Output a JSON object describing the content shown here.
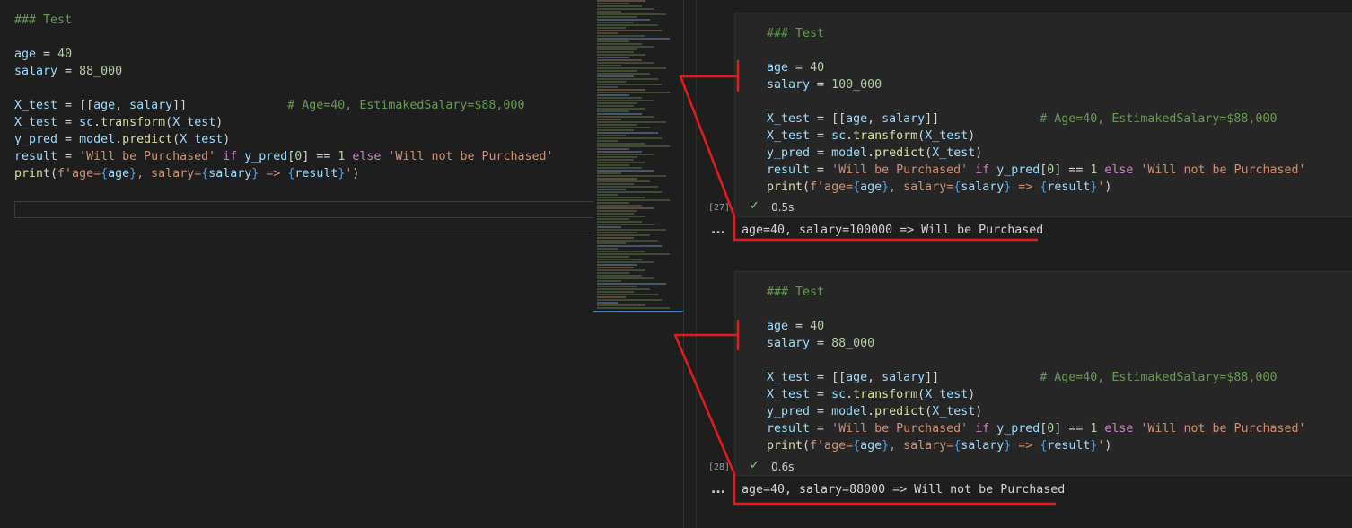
{
  "left_editor": {
    "lines": [
      [
        {
          "t": "### Test",
          "c": "comment"
        }
      ],
      [],
      [
        {
          "t": "age",
          "c": "var"
        },
        {
          "t": " = ",
          "c": "plain"
        },
        {
          "t": "40",
          "c": "num"
        }
      ],
      [
        {
          "t": "salary",
          "c": "var"
        },
        {
          "t": " = ",
          "c": "plain"
        },
        {
          "t": "88_000",
          "c": "num"
        }
      ],
      [],
      [
        {
          "t": "X_test",
          "c": "var"
        },
        {
          "t": " = [[",
          "c": "plain"
        },
        {
          "t": "age",
          "c": "var"
        },
        {
          "t": ", ",
          "c": "plain"
        },
        {
          "t": "salary",
          "c": "var"
        },
        {
          "t": "]]              ",
          "c": "plain"
        },
        {
          "t": "# Age=40, EstimakedSalary=$88,000",
          "c": "comment"
        }
      ],
      [
        {
          "t": "X_test",
          "c": "var"
        },
        {
          "t": " = ",
          "c": "plain"
        },
        {
          "t": "sc",
          "c": "var"
        },
        {
          "t": ".",
          "c": "plain"
        },
        {
          "t": "transform",
          "c": "fn"
        },
        {
          "t": "(",
          "c": "plain"
        },
        {
          "t": "X_test",
          "c": "var"
        },
        {
          "t": ")",
          "c": "plain"
        }
      ],
      [
        {
          "t": "y_pred",
          "c": "var"
        },
        {
          "t": " = ",
          "c": "plain"
        },
        {
          "t": "model",
          "c": "var"
        },
        {
          "t": ".",
          "c": "plain"
        },
        {
          "t": "predict",
          "c": "fn"
        },
        {
          "t": "(",
          "c": "plain"
        },
        {
          "t": "X_test",
          "c": "var"
        },
        {
          "t": ")",
          "c": "plain"
        }
      ],
      [
        {
          "t": "result",
          "c": "var"
        },
        {
          "t": " = ",
          "c": "plain"
        },
        {
          "t": "'Will be Purchased'",
          "c": "str"
        },
        {
          "t": " ",
          "c": "plain"
        },
        {
          "t": "if",
          "c": "kw"
        },
        {
          "t": " ",
          "c": "plain"
        },
        {
          "t": "y_pred",
          "c": "var"
        },
        {
          "t": "[",
          "c": "plain"
        },
        {
          "t": "0",
          "c": "num"
        },
        {
          "t": "] == ",
          "c": "plain"
        },
        {
          "t": "1",
          "c": "num"
        },
        {
          "t": " ",
          "c": "plain"
        },
        {
          "t": "else",
          "c": "kw"
        },
        {
          "t": " ",
          "c": "plain"
        },
        {
          "t": "'Will not be Purchased'",
          "c": "str"
        }
      ],
      [
        {
          "t": "print",
          "c": "fn"
        },
        {
          "t": "(",
          "c": "plain"
        },
        {
          "t": "f'age=",
          "c": "str"
        },
        {
          "t": "{",
          "c": "brace"
        },
        {
          "t": "age",
          "c": "var"
        },
        {
          "t": "}",
          "c": "brace"
        },
        {
          "t": ", salary=",
          "c": "str"
        },
        {
          "t": "{",
          "c": "brace"
        },
        {
          "t": "salary",
          "c": "var"
        },
        {
          "t": "}",
          "c": "brace"
        },
        {
          "t": " => ",
          "c": "str"
        },
        {
          "t": "{",
          "c": "brace"
        },
        {
          "t": "result",
          "c": "var"
        },
        {
          "t": "}",
          "c": "brace"
        },
        {
          "t": "'",
          "c": "str"
        },
        {
          "t": ")",
          "c": "plain"
        }
      ]
    ]
  },
  "cells": [
    {
      "exec_count": "[27]",
      "status_icon": "check-icon",
      "duration": "0.5s",
      "more_label": "...",
      "output": "age=40, salary=100000 => Will be Purchased",
      "lines": [
        [
          {
            "t": "### Test",
            "c": "comment"
          }
        ],
        [],
        [
          {
            "t": "age",
            "c": "var"
          },
          {
            "t": " = ",
            "c": "plain"
          },
          {
            "t": "40",
            "c": "num"
          }
        ],
        [
          {
            "t": "salary",
            "c": "var"
          },
          {
            "t": " = ",
            "c": "plain"
          },
          {
            "t": "100_000",
            "c": "num"
          }
        ],
        [],
        [
          {
            "t": "X_test",
            "c": "var"
          },
          {
            "t": " = [[",
            "c": "plain"
          },
          {
            "t": "age",
            "c": "var"
          },
          {
            "t": ", ",
            "c": "plain"
          },
          {
            "t": "salary",
            "c": "var"
          },
          {
            "t": "]]              ",
            "c": "plain"
          },
          {
            "t": "# Age=40, EstimakedSalary=$88,000",
            "c": "comment"
          }
        ],
        [
          {
            "t": "X_test",
            "c": "var"
          },
          {
            "t": " = ",
            "c": "plain"
          },
          {
            "t": "sc",
            "c": "var"
          },
          {
            "t": ".",
            "c": "plain"
          },
          {
            "t": "transform",
            "c": "fn"
          },
          {
            "t": "(",
            "c": "plain"
          },
          {
            "t": "X_test",
            "c": "var"
          },
          {
            "t": ")",
            "c": "plain"
          }
        ],
        [
          {
            "t": "y_pred",
            "c": "var"
          },
          {
            "t": " = ",
            "c": "plain"
          },
          {
            "t": "model",
            "c": "var"
          },
          {
            "t": ".",
            "c": "plain"
          },
          {
            "t": "predict",
            "c": "fn"
          },
          {
            "t": "(",
            "c": "plain"
          },
          {
            "t": "X_test",
            "c": "var"
          },
          {
            "t": ")",
            "c": "plain"
          }
        ],
        [
          {
            "t": "result",
            "c": "var"
          },
          {
            "t": " = ",
            "c": "plain"
          },
          {
            "t": "'Will be Purchased'",
            "c": "str"
          },
          {
            "t": " ",
            "c": "plain"
          },
          {
            "t": "if",
            "c": "kw"
          },
          {
            "t": " ",
            "c": "plain"
          },
          {
            "t": "y_pred",
            "c": "var"
          },
          {
            "t": "[",
            "c": "plain"
          },
          {
            "t": "0",
            "c": "num"
          },
          {
            "t": "] == ",
            "c": "plain"
          },
          {
            "t": "1",
            "c": "num"
          },
          {
            "t": " ",
            "c": "plain"
          },
          {
            "t": "else",
            "c": "kw"
          },
          {
            "t": " ",
            "c": "plain"
          },
          {
            "t": "'Will not be Purchased'",
            "c": "str"
          }
        ],
        [
          {
            "t": "print",
            "c": "fn"
          },
          {
            "t": "(",
            "c": "plain"
          },
          {
            "t": "f'age=",
            "c": "str"
          },
          {
            "t": "{",
            "c": "brace"
          },
          {
            "t": "age",
            "c": "var"
          },
          {
            "t": "}",
            "c": "brace"
          },
          {
            "t": ", salary=",
            "c": "str"
          },
          {
            "t": "{",
            "c": "brace"
          },
          {
            "t": "salary",
            "c": "var"
          },
          {
            "t": "}",
            "c": "brace"
          },
          {
            "t": " => ",
            "c": "str"
          },
          {
            "t": "{",
            "c": "brace"
          },
          {
            "t": "result",
            "c": "var"
          },
          {
            "t": "}",
            "c": "brace"
          },
          {
            "t": "'",
            "c": "str"
          },
          {
            "t": ")",
            "c": "plain"
          }
        ]
      ]
    },
    {
      "exec_count": "[28]",
      "status_icon": "check-icon",
      "duration": "0.6s",
      "more_label": "...",
      "output": "age=40, salary=88000 => Will not be Purchased",
      "lines": [
        [
          {
            "t": "### Test",
            "c": "comment"
          }
        ],
        [],
        [
          {
            "t": "age",
            "c": "var"
          },
          {
            "t": " = ",
            "c": "plain"
          },
          {
            "t": "40",
            "c": "num"
          }
        ],
        [
          {
            "t": "salary",
            "c": "var"
          },
          {
            "t": " = ",
            "c": "plain"
          },
          {
            "t": "88_000",
            "c": "num"
          }
        ],
        [],
        [
          {
            "t": "X_test",
            "c": "var"
          },
          {
            "t": " = [[",
            "c": "plain"
          },
          {
            "t": "age",
            "c": "var"
          },
          {
            "t": ", ",
            "c": "plain"
          },
          {
            "t": "salary",
            "c": "var"
          },
          {
            "t": "]]              ",
            "c": "plain"
          },
          {
            "t": "# Age=40, EstimakedSalary=$88,000",
            "c": "comment"
          }
        ],
        [
          {
            "t": "X_test",
            "c": "var"
          },
          {
            "t": " = ",
            "c": "plain"
          },
          {
            "t": "sc",
            "c": "var"
          },
          {
            "t": ".",
            "c": "plain"
          },
          {
            "t": "transform",
            "c": "fn"
          },
          {
            "t": "(",
            "c": "plain"
          },
          {
            "t": "X_test",
            "c": "var"
          },
          {
            "t": ")",
            "c": "plain"
          }
        ],
        [
          {
            "t": "y_pred",
            "c": "var"
          },
          {
            "t": " = ",
            "c": "plain"
          },
          {
            "t": "model",
            "c": "var"
          },
          {
            "t": ".",
            "c": "plain"
          },
          {
            "t": "predict",
            "c": "fn"
          },
          {
            "t": "(",
            "c": "plain"
          },
          {
            "t": "X_test",
            "c": "var"
          },
          {
            "t": ")",
            "c": "plain"
          }
        ],
        [
          {
            "t": "result",
            "c": "var"
          },
          {
            "t": " = ",
            "c": "plain"
          },
          {
            "t": "'Will be Purchased'",
            "c": "str"
          },
          {
            "t": " ",
            "c": "plain"
          },
          {
            "t": "if",
            "c": "kw"
          },
          {
            "t": " ",
            "c": "plain"
          },
          {
            "t": "y_pred",
            "c": "var"
          },
          {
            "t": "[",
            "c": "plain"
          },
          {
            "t": "0",
            "c": "num"
          },
          {
            "t": "] == ",
            "c": "plain"
          },
          {
            "t": "1",
            "c": "num"
          },
          {
            "t": " ",
            "c": "plain"
          },
          {
            "t": "else",
            "c": "kw"
          },
          {
            "t": " ",
            "c": "plain"
          },
          {
            "t": "'Will not be Purchased'",
            "c": "str"
          }
        ],
        [
          {
            "t": "print",
            "c": "fn"
          },
          {
            "t": "(",
            "c": "plain"
          },
          {
            "t": "f'age=",
            "c": "str"
          },
          {
            "t": "{",
            "c": "brace"
          },
          {
            "t": "age",
            "c": "var"
          },
          {
            "t": "}",
            "c": "brace"
          },
          {
            "t": ", salary=",
            "c": "str"
          },
          {
            "t": "{",
            "c": "brace"
          },
          {
            "t": "salary",
            "c": "var"
          },
          {
            "t": "}",
            "c": "brace"
          },
          {
            "t": " => ",
            "c": "str"
          },
          {
            "t": "{",
            "c": "brace"
          },
          {
            "t": "result",
            "c": "var"
          },
          {
            "t": "}",
            "c": "brace"
          },
          {
            "t": "'",
            "c": "str"
          },
          {
            "t": ")",
            "c": "plain"
          }
        ]
      ]
    }
  ],
  "colors": {
    "background": "#1e1e1e",
    "cell_background": "#262626",
    "annotation_red": "#e51b1b",
    "focus_blue": "#3b76c7",
    "check_green": "#89d185"
  }
}
